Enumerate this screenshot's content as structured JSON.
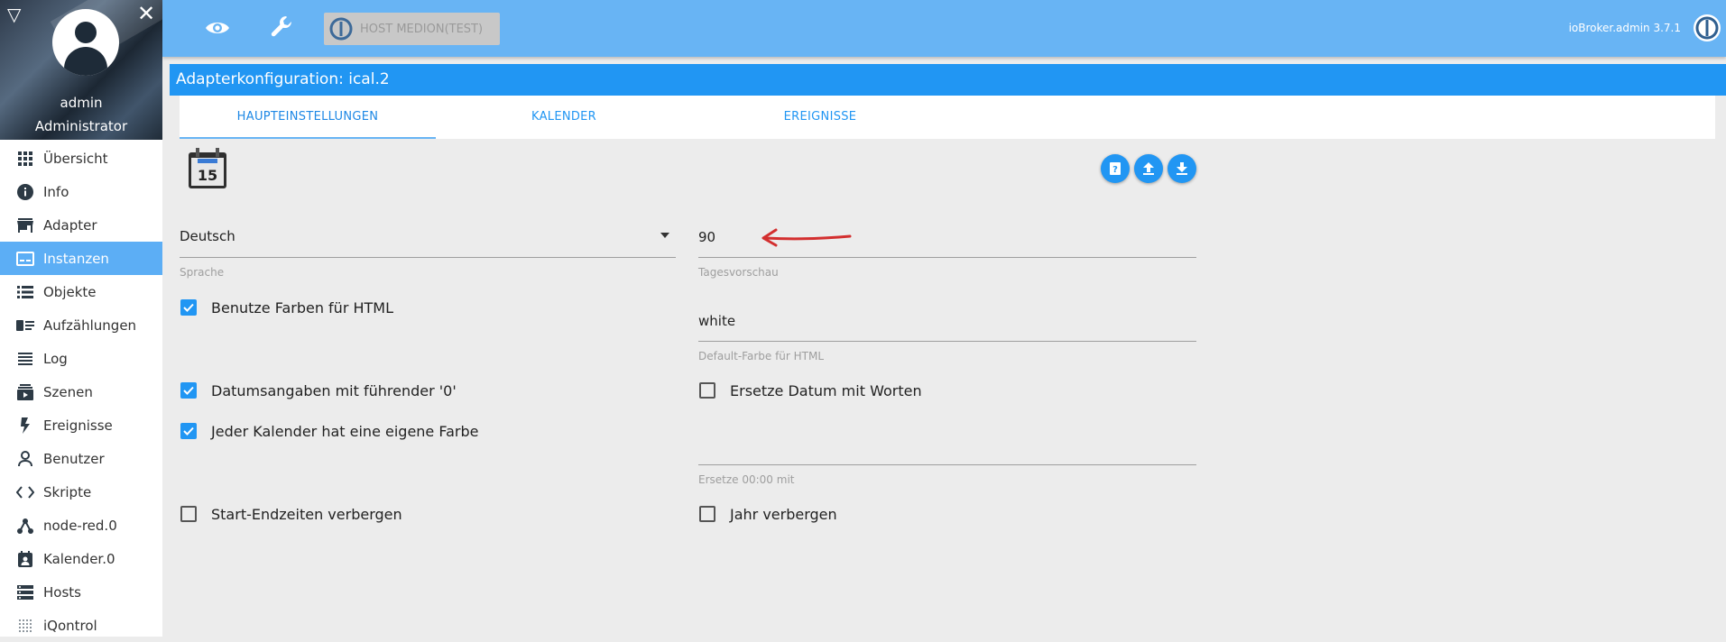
{
  "sidebar": {
    "user_name": "admin",
    "user_role": "Administrator",
    "items": [
      {
        "label": "Übersicht",
        "icon": "apps-grid-icon",
        "active": false
      },
      {
        "label": "Info",
        "icon": "info-icon",
        "active": false
      },
      {
        "label": "Adapter",
        "icon": "store-icon",
        "active": false
      },
      {
        "label": "Instanzen",
        "icon": "instances-icon",
        "active": true
      },
      {
        "label": "Objekte",
        "icon": "list-icon",
        "active": false
      },
      {
        "label": "Aufzählungen",
        "icon": "enum-icon",
        "active": false
      },
      {
        "label": "Log",
        "icon": "log-icon",
        "active": false
      },
      {
        "label": "Szenen",
        "icon": "scenes-icon",
        "active": false
      },
      {
        "label": "Ereignisse",
        "icon": "flash-icon",
        "active": false
      },
      {
        "label": "Benutzer",
        "icon": "user-icon",
        "active": false
      },
      {
        "label": "Skripte",
        "icon": "code-icon",
        "active": false
      },
      {
        "label": "node-red.0",
        "icon": "node-red-icon",
        "active": false
      },
      {
        "label": "Kalender.0",
        "icon": "calendar-user-icon",
        "active": false
      },
      {
        "label": "Hosts",
        "icon": "hosts-icon",
        "active": false
      },
      {
        "label": "iQontrol",
        "icon": "dots-grid-icon",
        "active": false
      }
    ]
  },
  "header": {
    "host_label": "HOST MEDION(TEST)",
    "version": "ioBroker.admin 3.7.1"
  },
  "title": "Adapterkonfiguration: ical.2",
  "tabs": [
    {
      "label": "HAUPTEINSTELLUNGEN",
      "active": true
    },
    {
      "label": "KALENDER",
      "active": false
    },
    {
      "label": "EREIGNISSE",
      "active": false
    }
  ],
  "form": {
    "language": {
      "value": "Deutsch",
      "label": "Sprache"
    },
    "days_preview": {
      "value": "90",
      "label": "Tagesvorschau"
    },
    "use_colors": {
      "label": "Benutze Farben für HTML",
      "checked": true
    },
    "default_color": {
      "value": "white",
      "label": "Default-Farbe für HTML"
    },
    "leading_zero": {
      "label": "Datumsangaben mit führender '0'",
      "checked": true
    },
    "replace_dates": {
      "label": "Ersetze Datum mit Worten",
      "checked": false
    },
    "own_color": {
      "label": "Jeder Kalender hat eine eigene Farbe",
      "checked": true
    },
    "replace_midnight": {
      "value": "",
      "label": "Ersetze 00:00 mit"
    },
    "hide_times": {
      "label": "Start-Endzeiten verbergen",
      "checked": false
    },
    "hide_year": {
      "label": "Jahr verbergen",
      "checked": false
    }
  },
  "colors": {
    "header_bg": "#68b4f4",
    "accent": "#2196f3",
    "active_nav": "#5caef5",
    "annotation_arrow": "#d32f2f"
  }
}
